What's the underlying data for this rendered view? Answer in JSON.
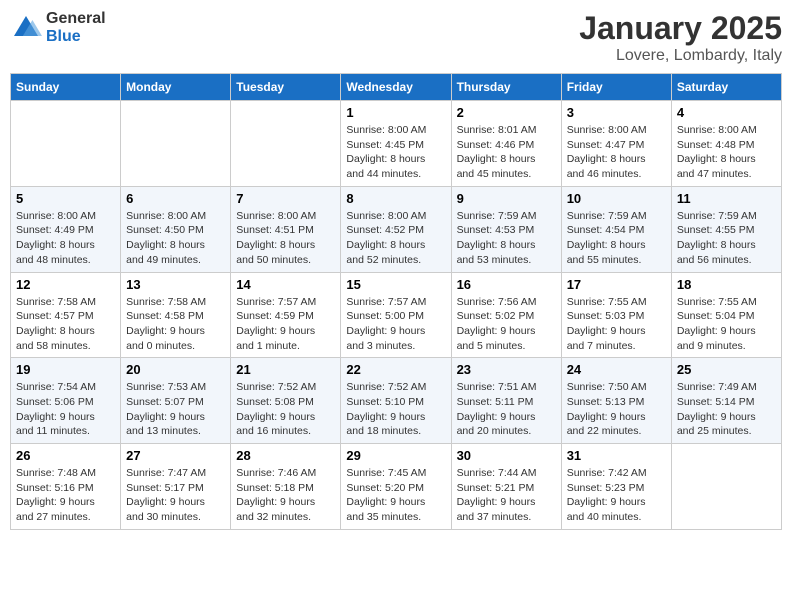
{
  "header": {
    "logo_general": "General",
    "logo_blue": "Blue",
    "month_title": "January 2025",
    "location": "Lovere, Lombardy, Italy"
  },
  "weekdays": [
    "Sunday",
    "Monday",
    "Tuesday",
    "Wednesday",
    "Thursday",
    "Friday",
    "Saturday"
  ],
  "weeks": [
    [
      {
        "day": "",
        "info": ""
      },
      {
        "day": "",
        "info": ""
      },
      {
        "day": "",
        "info": ""
      },
      {
        "day": "1",
        "info": "Sunrise: 8:00 AM\nSunset: 4:45 PM\nDaylight: 8 hours\nand 44 minutes."
      },
      {
        "day": "2",
        "info": "Sunrise: 8:01 AM\nSunset: 4:46 PM\nDaylight: 8 hours\nand 45 minutes."
      },
      {
        "day": "3",
        "info": "Sunrise: 8:00 AM\nSunset: 4:47 PM\nDaylight: 8 hours\nand 46 minutes."
      },
      {
        "day": "4",
        "info": "Sunrise: 8:00 AM\nSunset: 4:48 PM\nDaylight: 8 hours\nand 47 minutes."
      }
    ],
    [
      {
        "day": "5",
        "info": "Sunrise: 8:00 AM\nSunset: 4:49 PM\nDaylight: 8 hours\nand 48 minutes."
      },
      {
        "day": "6",
        "info": "Sunrise: 8:00 AM\nSunset: 4:50 PM\nDaylight: 8 hours\nand 49 minutes."
      },
      {
        "day": "7",
        "info": "Sunrise: 8:00 AM\nSunset: 4:51 PM\nDaylight: 8 hours\nand 50 minutes."
      },
      {
        "day": "8",
        "info": "Sunrise: 8:00 AM\nSunset: 4:52 PM\nDaylight: 8 hours\nand 52 minutes."
      },
      {
        "day": "9",
        "info": "Sunrise: 7:59 AM\nSunset: 4:53 PM\nDaylight: 8 hours\nand 53 minutes."
      },
      {
        "day": "10",
        "info": "Sunrise: 7:59 AM\nSunset: 4:54 PM\nDaylight: 8 hours\nand 55 minutes."
      },
      {
        "day": "11",
        "info": "Sunrise: 7:59 AM\nSunset: 4:55 PM\nDaylight: 8 hours\nand 56 minutes."
      }
    ],
    [
      {
        "day": "12",
        "info": "Sunrise: 7:58 AM\nSunset: 4:57 PM\nDaylight: 8 hours\nand 58 minutes."
      },
      {
        "day": "13",
        "info": "Sunrise: 7:58 AM\nSunset: 4:58 PM\nDaylight: 9 hours\nand 0 minutes."
      },
      {
        "day": "14",
        "info": "Sunrise: 7:57 AM\nSunset: 4:59 PM\nDaylight: 9 hours\nand 1 minute."
      },
      {
        "day": "15",
        "info": "Sunrise: 7:57 AM\nSunset: 5:00 PM\nDaylight: 9 hours\nand 3 minutes."
      },
      {
        "day": "16",
        "info": "Sunrise: 7:56 AM\nSunset: 5:02 PM\nDaylight: 9 hours\nand 5 minutes."
      },
      {
        "day": "17",
        "info": "Sunrise: 7:55 AM\nSunset: 5:03 PM\nDaylight: 9 hours\nand 7 minutes."
      },
      {
        "day": "18",
        "info": "Sunrise: 7:55 AM\nSunset: 5:04 PM\nDaylight: 9 hours\nand 9 minutes."
      }
    ],
    [
      {
        "day": "19",
        "info": "Sunrise: 7:54 AM\nSunset: 5:06 PM\nDaylight: 9 hours\nand 11 minutes."
      },
      {
        "day": "20",
        "info": "Sunrise: 7:53 AM\nSunset: 5:07 PM\nDaylight: 9 hours\nand 13 minutes."
      },
      {
        "day": "21",
        "info": "Sunrise: 7:52 AM\nSunset: 5:08 PM\nDaylight: 9 hours\nand 16 minutes."
      },
      {
        "day": "22",
        "info": "Sunrise: 7:52 AM\nSunset: 5:10 PM\nDaylight: 9 hours\nand 18 minutes."
      },
      {
        "day": "23",
        "info": "Sunrise: 7:51 AM\nSunset: 5:11 PM\nDaylight: 9 hours\nand 20 minutes."
      },
      {
        "day": "24",
        "info": "Sunrise: 7:50 AM\nSunset: 5:13 PM\nDaylight: 9 hours\nand 22 minutes."
      },
      {
        "day": "25",
        "info": "Sunrise: 7:49 AM\nSunset: 5:14 PM\nDaylight: 9 hours\nand 25 minutes."
      }
    ],
    [
      {
        "day": "26",
        "info": "Sunrise: 7:48 AM\nSunset: 5:16 PM\nDaylight: 9 hours\nand 27 minutes."
      },
      {
        "day": "27",
        "info": "Sunrise: 7:47 AM\nSunset: 5:17 PM\nDaylight: 9 hours\nand 30 minutes."
      },
      {
        "day": "28",
        "info": "Sunrise: 7:46 AM\nSunset: 5:18 PM\nDaylight: 9 hours\nand 32 minutes."
      },
      {
        "day": "29",
        "info": "Sunrise: 7:45 AM\nSunset: 5:20 PM\nDaylight: 9 hours\nand 35 minutes."
      },
      {
        "day": "30",
        "info": "Sunrise: 7:44 AM\nSunset: 5:21 PM\nDaylight: 9 hours\nand 37 minutes."
      },
      {
        "day": "31",
        "info": "Sunrise: 7:42 AM\nSunset: 5:23 PM\nDaylight: 9 hours\nand 40 minutes."
      },
      {
        "day": "",
        "info": ""
      }
    ]
  ]
}
